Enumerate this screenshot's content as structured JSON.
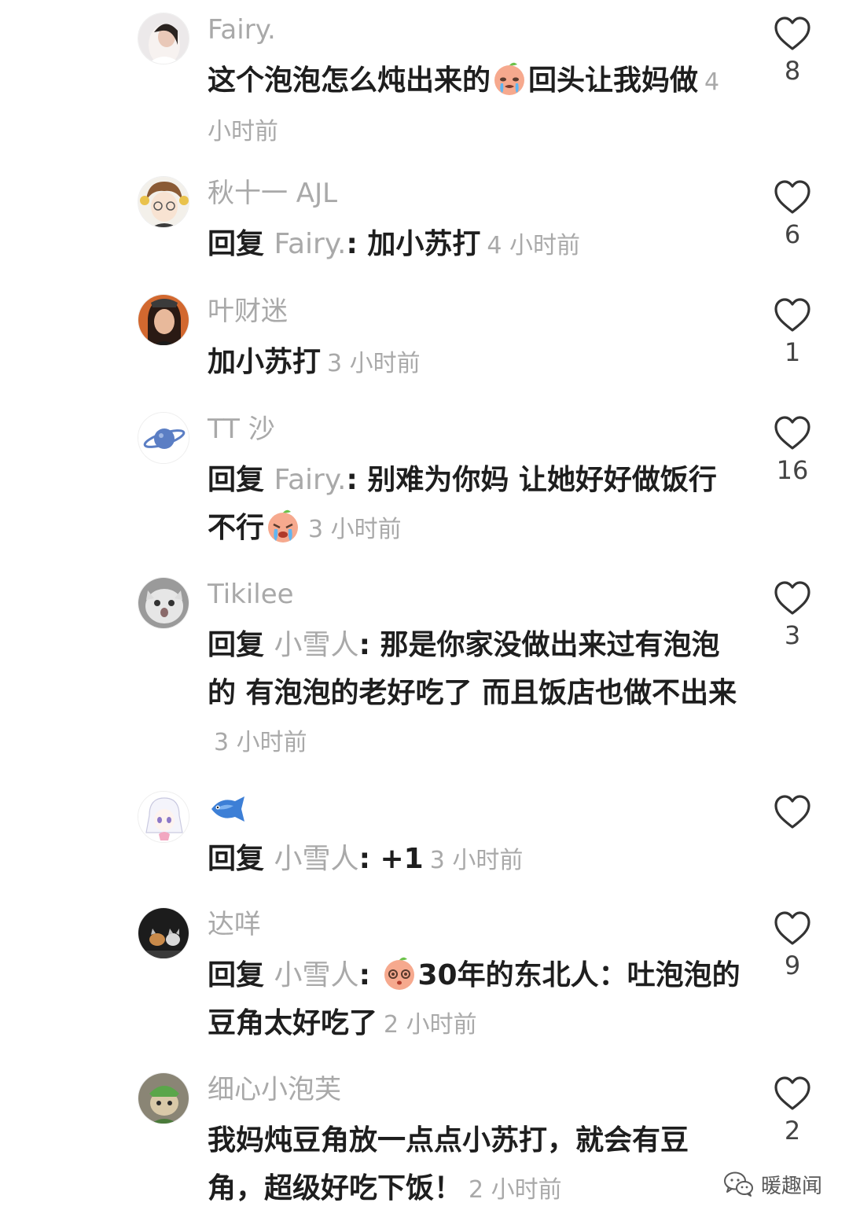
{
  "comments": [
    {
      "username": "Fairy.",
      "text_before": "这个泡泡怎么炖出来的",
      "emoji": "crying-peach-emoji",
      "text_after": "回头让我妈做",
      "time": "4 小时前",
      "likes": "8"
    },
    {
      "username": "秋十一 AJL",
      "reply_prefix": "回复 ",
      "reply_to": "Fairy.",
      "reply_colon": ": ",
      "text": "加小苏打",
      "time": "4 小时前",
      "likes": "6"
    },
    {
      "username": "叶财迷",
      "text": "加小苏打",
      "time": "3 小时前",
      "likes": "1"
    },
    {
      "username": "TT 沙",
      "reply_prefix": "回复 ",
      "reply_to": "Fairy.",
      "reply_colon": ": ",
      "text": "别难为你妈 让她好好做饭行不行",
      "emoji": "crying-peach-emoji",
      "time": "3 小时前",
      "likes": "16"
    },
    {
      "username": "Tikilee",
      "reply_prefix": "回复 ",
      "reply_to": "小雪人",
      "reply_colon": ": ",
      "text": "那是你家没做出来过有泡泡的 有泡泡的老好吃了 而且饭店也做不出来",
      "time": "3 小时前",
      "likes": "3"
    },
    {
      "username_emoji": "fish-emoji",
      "reply_prefix": "回复 ",
      "reply_to": "小雪人",
      "reply_colon": ": ",
      "text": "+1",
      "time": "3 小时前",
      "likes": ""
    },
    {
      "username": "达咩",
      "reply_prefix": "回复 ",
      "reply_to": "小雪人",
      "reply_colon": ": ",
      "emoji": "dazed-peach-emoji",
      "text": "30年的东北人：吐泡泡的豆角太好吃了",
      "time": "2 小时前",
      "likes": "9"
    },
    {
      "username": "细心小泡芙",
      "text": "我妈炖豆角放一点点小苏打，就会有豆角，超级好吃下饭！",
      "time": "2 小时前",
      "likes": "2"
    }
  ],
  "watermark": {
    "icon": "wechat-icon",
    "label": "暖趣闻"
  },
  "colors": {
    "username": "#a9a9a9",
    "text": "#1e1e1e",
    "timestamp": "#a9a9a9",
    "heart_outline": "#333333"
  }
}
